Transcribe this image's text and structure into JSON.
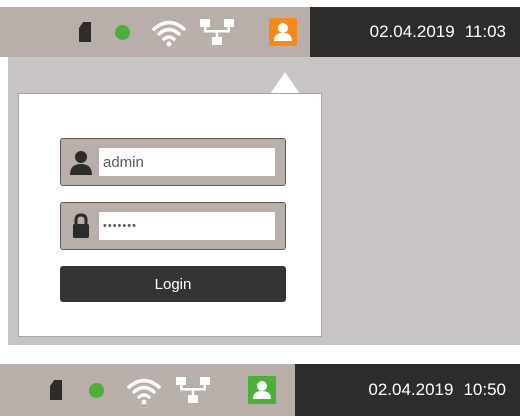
{
  "status_bars": [
    {
      "date": "02.04.2019",
      "time": "11:03",
      "user_button_color": "#f28a1f",
      "user_state": "active"
    },
    {
      "date": "02.04.2019",
      "time": "10:50",
      "user_button_color": "#4caf3a",
      "user_state": "logged-in"
    }
  ],
  "icons": {
    "storage": "sd-card-icon",
    "status_led": "status-led-icon",
    "wifi": "wifi-icon",
    "network": "network-icon",
    "user": "user-icon",
    "lock": "lock-icon"
  },
  "login_form": {
    "username_value": "admin",
    "password_value": "•••••••",
    "login_label": "Login"
  },
  "colors": {
    "bar_status": "#b8aeaa",
    "bar_clock": "#2e2b2b",
    "led_green": "#4caf3a",
    "accent_orange": "#f28a1f",
    "button_dark": "#363333"
  }
}
